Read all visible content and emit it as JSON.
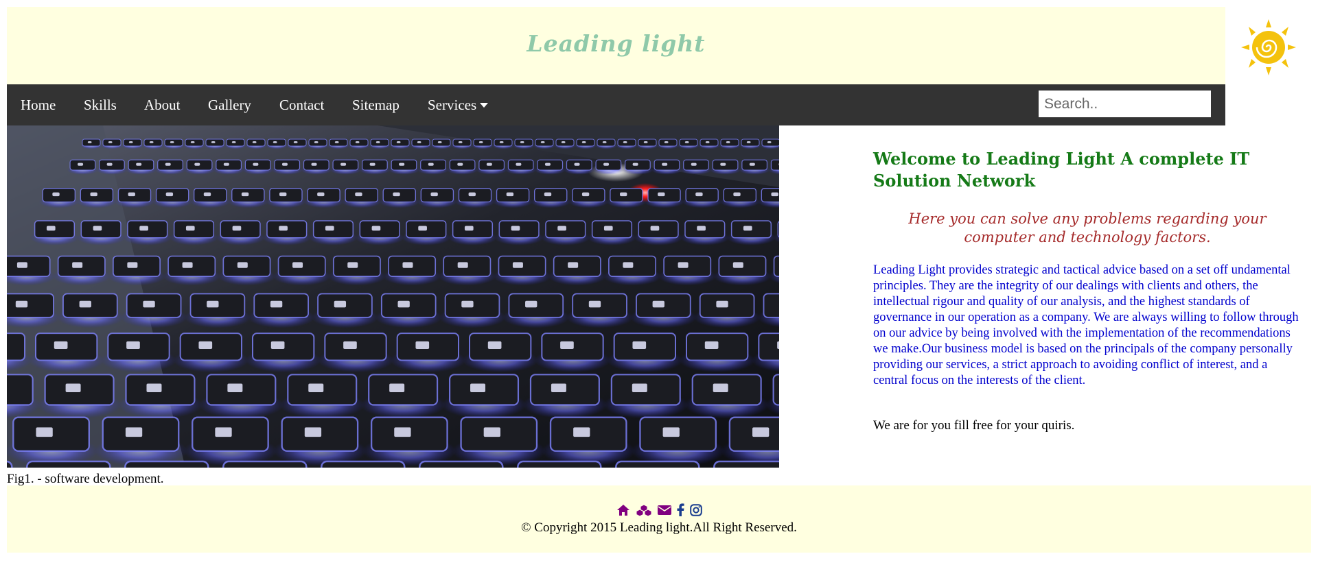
{
  "header": {
    "brand": "Leading light",
    "logo_icon": "sun-icon"
  },
  "nav": {
    "items": [
      {
        "label": "Home"
      },
      {
        "label": "Skills"
      },
      {
        "label": "About"
      },
      {
        "label": "Gallery"
      },
      {
        "label": "Contact"
      },
      {
        "label": "Sitemap"
      },
      {
        "label": "Services",
        "icon": "caret-down-icon"
      }
    ],
    "search_placeholder": "Search.."
  },
  "hero": {
    "caption": "Fig1. - software development."
  },
  "content": {
    "welcome": "Welcome to Leading Light A complete IT Solution Network",
    "tagline": "Here you can solve any problems regarding your computer and technology factors.",
    "body": "Leading Light provides strategic and tactical advice based on a set off undamental principles. They are the integrity of our dealings with clients and others, the intellectual rigour and quality of our analysis, and the highest standards of governance in our operation as a company. We are always willing to follow through on our advice by being involved with the implementation of the recommendations we make.Our business model is based on the principals of the company personally providing our services, a strict approach to avoiding conflict of interest, and a central focus on the interests of the client.",
    "invite": "We are for you fill free for your quiris."
  },
  "footer": {
    "icons": [
      "home-icon",
      "cubes-icon",
      "envelope-icon",
      "facebook-icon",
      "instagram-icon"
    ],
    "copyright": "© Copyright 2015 Leading light.All Right Reserved."
  },
  "colors": {
    "header_bg": "#ffffe0",
    "nav_bg": "#333333",
    "brand": "#8fc9a9",
    "welcome": "#157a17",
    "tagline": "#a52a2a",
    "body": "#0000cd",
    "footer_icons_purple": "#800080",
    "footer_icons_blue": "#1a3d8f"
  }
}
